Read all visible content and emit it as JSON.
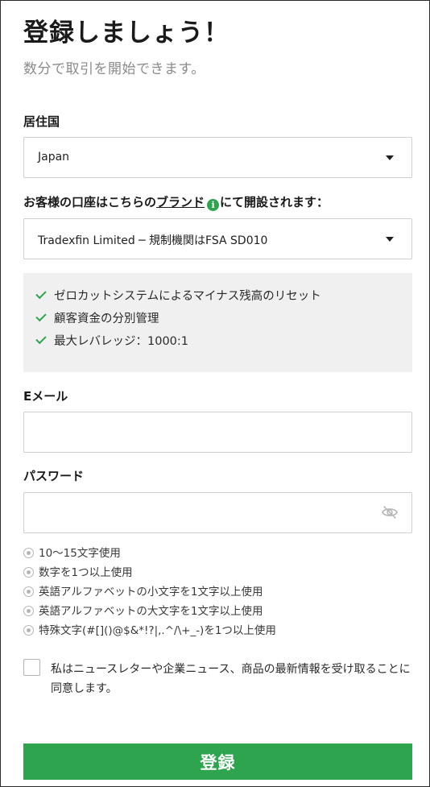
{
  "header": {
    "title": "登録しましょう！",
    "subtitle": "数分で取引を開始できます。"
  },
  "country": {
    "label": "居住国",
    "value": "Japan"
  },
  "account_entity": {
    "label_prefix": "お客様の口座はこちらの",
    "label_link": "ブランド",
    "info_icon": "i",
    "label_suffix": "にて開設されます：",
    "value": "Tradexfin Limited ─ 規制機関はFSA SD010"
  },
  "features": [
    "ゼロカットシステムによるマイナス残高のリセット",
    "顧客資金の分別管理",
    "最大レバレッジ：1000:1"
  ],
  "email": {
    "label": "Eメール",
    "value": "",
    "placeholder": ""
  },
  "password": {
    "label": "パスワード",
    "value": "",
    "placeholder": "",
    "rules": [
      "10〜15文字使用",
      "数字を1つ以上使用",
      "英語アルファベットの小文字を1文字以上使用",
      "英語アルファベットの大文字を1文字以上使用",
      "特殊文字(#[]()@$&*!?|,.^/\\+_-)を1つ以上使用"
    ]
  },
  "consent": {
    "text": "私はニュースレターや企業ニュース、商品の最新情報を受け取ることに同意します。",
    "checked": false
  },
  "submit": {
    "label": "登録"
  },
  "colors": {
    "accent_green": "#2ea44f",
    "feature_bg": "#f0f0f0",
    "border": "#cfcfcf"
  },
  "icons": [
    "chevron-down-icon",
    "info-icon",
    "check-icon",
    "eye-off-icon",
    "radio-icon"
  ]
}
